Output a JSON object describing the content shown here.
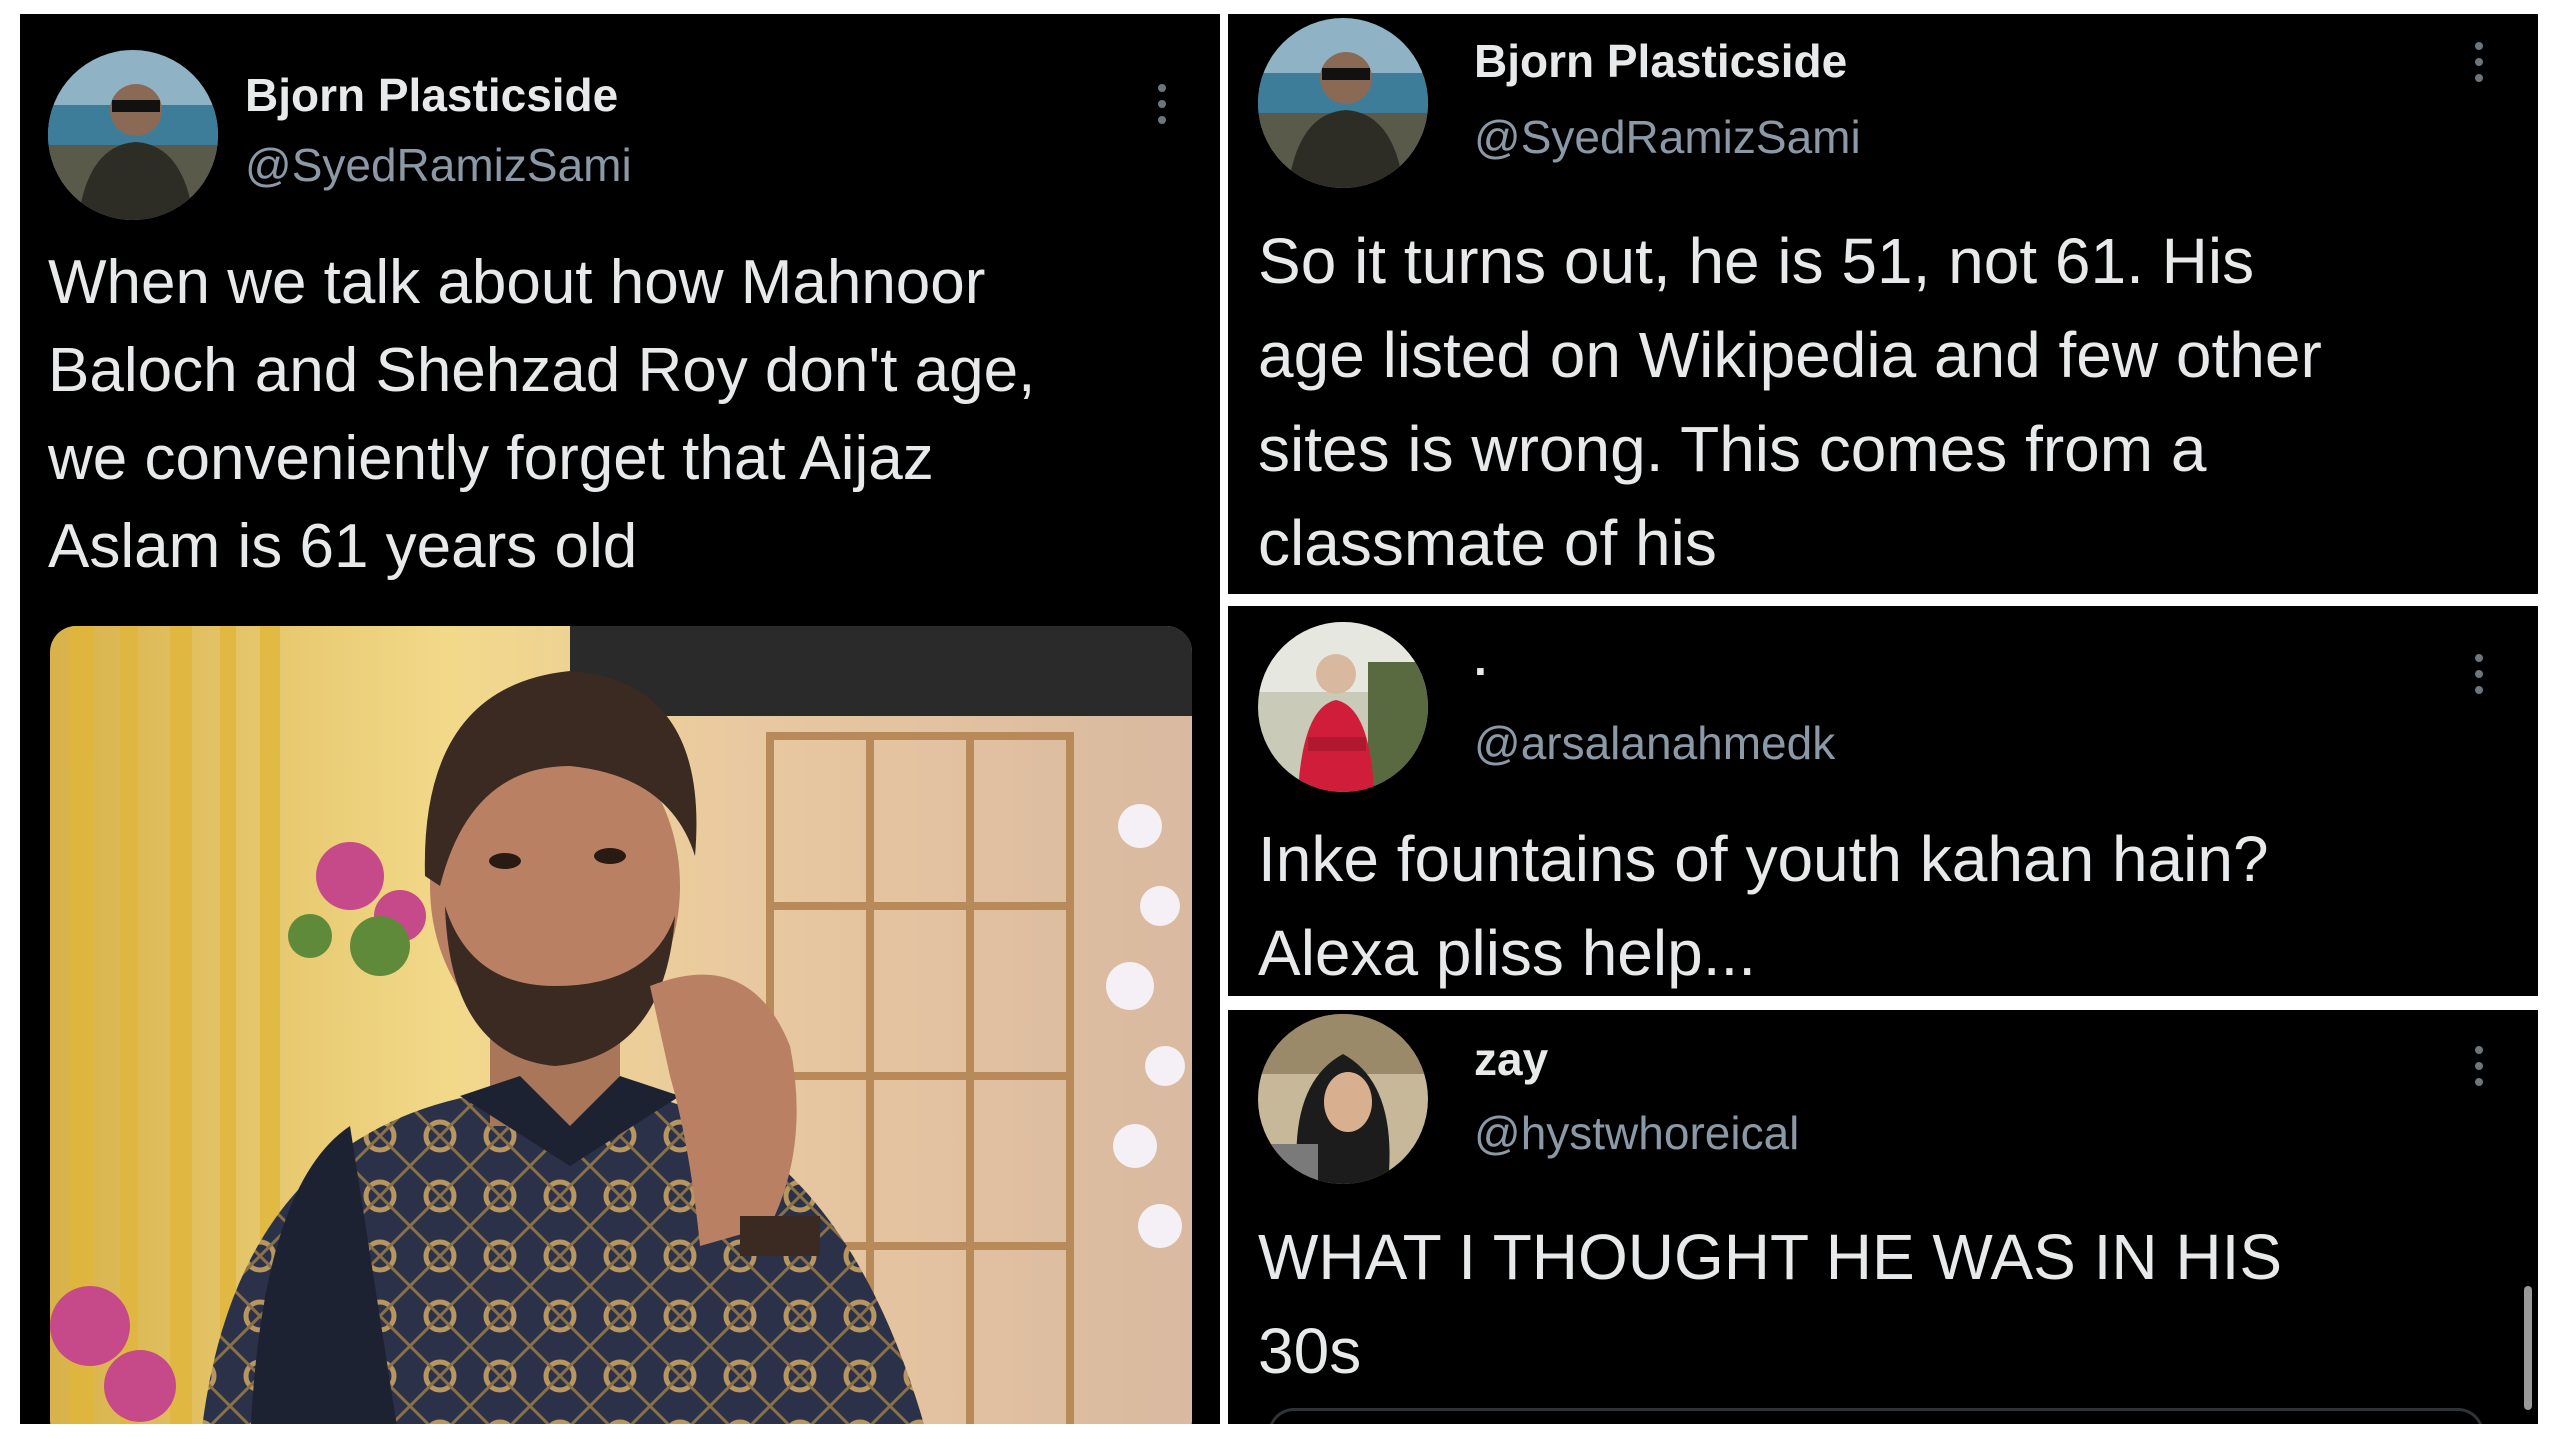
{
  "tweets": [
    {
      "name": "Bjorn Plasticside",
      "handle": "@SyedRamizSami",
      "text": "When we talk about how Mahnoor\nBaloch and Shehzad Roy don't age,\nwe conveniently forget that Aijaz\nAslam is 61 years old",
      "avatar_icon": "man-sunglasses-lake-avatar",
      "more_icon": "more-options-icon"
    },
    {
      "name": "Bjorn Plasticside",
      "handle": "@SyedRamizSami",
      "text": "So it turns out, he is 51, not 61. His\nage listed on Wikipedia and few other\nsites is wrong. This comes from a\nclassmate of his",
      "avatar_icon": "man-sunglasses-lake-avatar",
      "more_icon": "more-options-icon"
    },
    {
      "name": ".",
      "handle": "@arsalanahmedk",
      "text": "Inke fountains of youth kahan hain?\nAlexa pliss help...",
      "avatar_icon": "man-red-shirt-avatar",
      "more_icon": "more-options-icon"
    },
    {
      "name": "zay",
      "handle": "@hystwhoreical",
      "text": "WHAT I THOUGHT HE WAS IN HIS\n30s",
      "avatar_icon": "woman-hijab-avatar",
      "more_icon": "more-options-icon"
    }
  ],
  "colors": {
    "background": "#000000",
    "primary_text": "#e7e9ea",
    "secondary_text": "#8b98a5",
    "separator": "#ffffff"
  }
}
